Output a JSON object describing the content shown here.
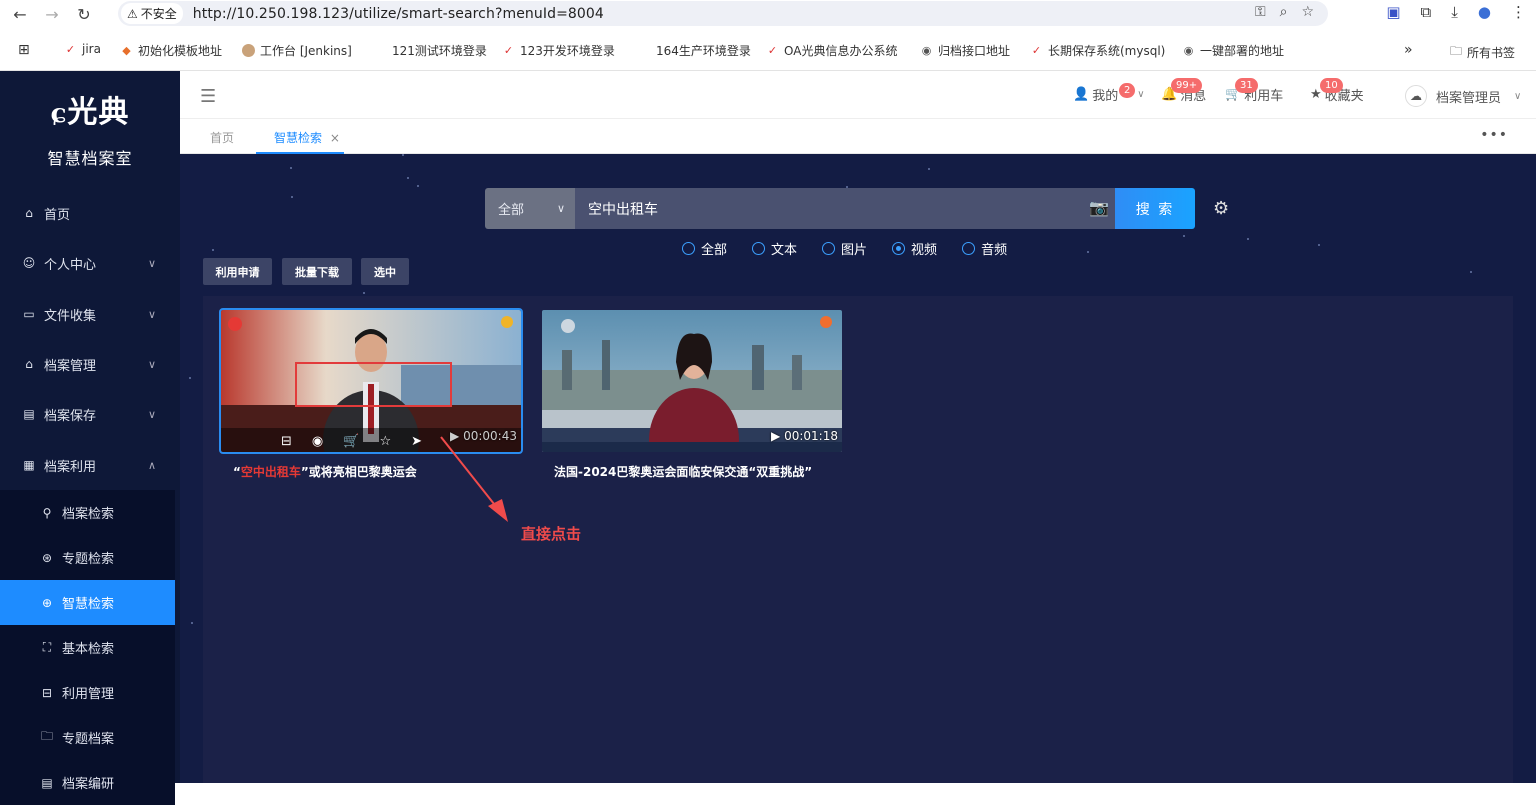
{
  "browser": {
    "insecure_label": "不安全",
    "url": "http://10.250.198.123/utilize/smart-search?menuId=8004",
    "bookmarks": [
      {
        "label": "jira"
      },
      {
        "label": "初始化模板地址"
      },
      {
        "label": "工作台 [Jenkins]"
      },
      {
        "label": "121测试环境登录"
      },
      {
        "label": "123开发环境登录"
      },
      {
        "label": "164生产环境登录"
      },
      {
        "label": "OA光典信息办公系统"
      },
      {
        "label": "归档接口地址"
      },
      {
        "label": "长期保存系统(mysql)"
      },
      {
        "label": "一键部署的地址"
      }
    ],
    "all_bookmarks": "所有书签"
  },
  "app": {
    "logo_text": "光典",
    "logo_sub": "智慧档案室",
    "menu": [
      {
        "label": "首页",
        "icon": "home-icon"
      },
      {
        "label": "个人中心",
        "icon": "user-icon"
      },
      {
        "label": "文件收集",
        "icon": "briefcase-icon"
      },
      {
        "label": "档案管理",
        "icon": "bank-icon"
      },
      {
        "label": "档案保存",
        "icon": "building-icon"
      },
      {
        "label": "档案利用",
        "icon": "calendar-icon"
      }
    ],
    "submenu": [
      {
        "label": "档案检索",
        "icon": "search-icon"
      },
      {
        "label": "专题检索",
        "icon": "aperture-icon"
      },
      {
        "label": "智慧检索",
        "icon": "globe-icon"
      },
      {
        "label": "基本检索",
        "icon": "scan-icon"
      },
      {
        "label": "利用管理",
        "icon": "book-icon"
      },
      {
        "label": "专题档案",
        "icon": "folder-icon"
      },
      {
        "label": "档案编研",
        "icon": "document-icon"
      }
    ],
    "header": {
      "mine": "我的",
      "mine_badge": "2",
      "messages": "消息",
      "messages_badge": "99+",
      "cart": "利用车",
      "cart_badge": "31",
      "favorites": "收藏夹",
      "favorites_badge": "10",
      "user": "档案管理员"
    },
    "tabs": [
      {
        "label": "首页"
      },
      {
        "label": "智慧检索"
      }
    ],
    "tab_close": "×",
    "search": {
      "scope": "全部",
      "query": "空中出租车",
      "button": "搜 索"
    },
    "filters": [
      "全部",
      "文本",
      "图片",
      "视频",
      "音频"
    ],
    "selected_filter": "视频",
    "actions": [
      "利用申请",
      "批量下载",
      "选中"
    ],
    "results": [
      {
        "title_prefix": "“",
        "title_highlight": "空中出租车",
        "title_suffix": "”或将亮相巴黎奥运会",
        "duration": "00:00:43"
      },
      {
        "title": "法国-2024巴黎奥运会面临安保交通“双重挑战”",
        "duration": "00:01:18"
      }
    ],
    "annotation": "直接点击"
  }
}
